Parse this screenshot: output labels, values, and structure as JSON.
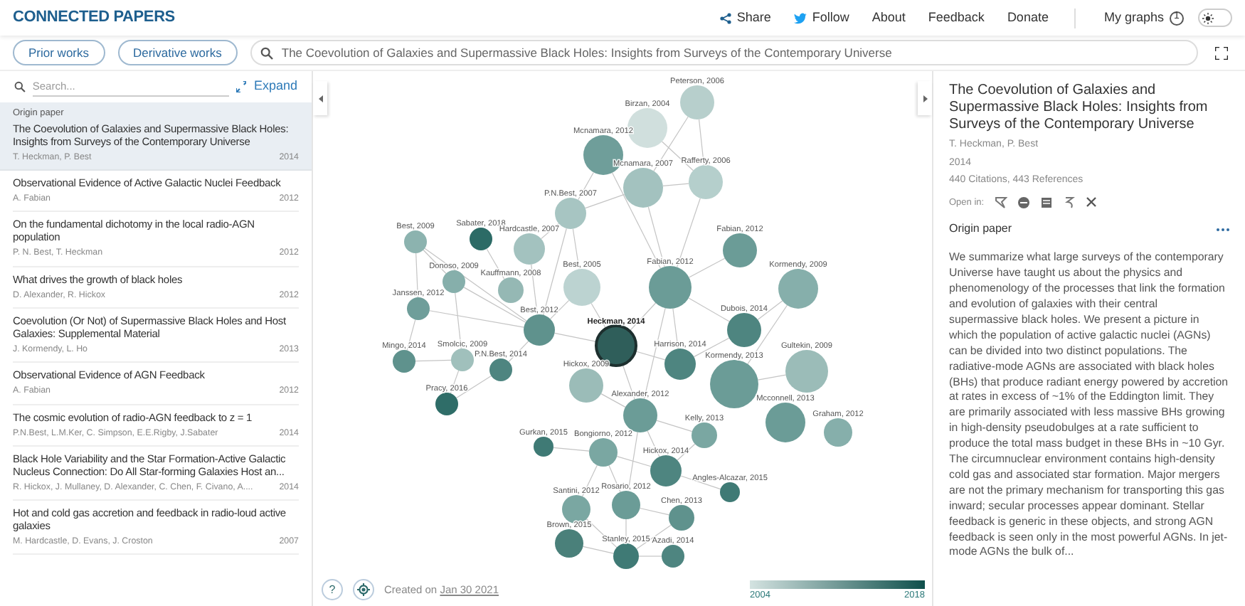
{
  "header": {
    "logo": "CONNECTED PAPERS",
    "nav": [
      {
        "kind": "share",
        "label": "Share"
      },
      {
        "kind": "follow",
        "label": "Follow"
      },
      {
        "kind": "plain",
        "label": "About"
      },
      {
        "kind": "plain",
        "label": "Feedback"
      },
      {
        "kind": "plain",
        "label": "Donate"
      }
    ],
    "my_graphs": {
      "label": "My graphs",
      "count": "1"
    },
    "dark_mode": false
  },
  "toolbar": {
    "buttons": [
      "Prior works",
      "Derivative works"
    ],
    "search_value": "The Coevolution of Galaxies and Supermassive Black Holes: Insights from Surveys of the Contemporary Universe"
  },
  "list_panel": {
    "search_placeholder": "Search...",
    "expand": "Expand",
    "papers": [
      {
        "tag": "Origin paper",
        "title": "The Coevolution of Galaxies and Supermassive Black Holes: Insights from Surveys of the Contemporary Universe",
        "authors": "T. Heckman, P. Best",
        "year": "2014",
        "selected": true
      },
      {
        "title": "Observational Evidence of Active Galactic Nuclei Feedback",
        "authors": "A. Fabian",
        "year": "2012",
        "selected": false
      },
      {
        "title": "On the fundamental dichotomy in the local radio-AGN population",
        "authors": "P. N. Best, T. Heckman",
        "year": "2012",
        "selected": false
      },
      {
        "title": "What drives the growth of black holes",
        "authors": "D. Alexander, R. Hickox",
        "year": "2012",
        "selected": false
      },
      {
        "title": "Coevolution (Or Not) of Supermassive Black Holes and Host Galaxies: Supplemental Material",
        "authors": "J. Kormendy, L. Ho",
        "year": "2013",
        "selected": false
      },
      {
        "title": "Observational Evidence of AGN Feedback",
        "authors": "A. Fabian",
        "year": "2012",
        "selected": false
      },
      {
        "title": "The cosmic evolution of radio-AGN feedback to z = 1",
        "authors": "P.N.Best, L.M.Ker, C. Simpson, E.E.Rigby, J.Sabater",
        "year": "2014",
        "selected": false
      },
      {
        "title": "Black Hole Variability and the Star Formation-Active Galactic Nucleus Connection: Do All Star-forming Galaxies Host an...",
        "authors": "R. Hickox, J. Mullaney, D. Alexander, C. Chen, F. Civano, A....",
        "year": "2014",
        "selected": false
      },
      {
        "title": "Hot and cold gas accretion and feedback in radio-loud active galaxies",
        "authors": "M. Hardcastle, D. Evans, J. Croston",
        "year": "2007",
        "selected": false
      }
    ]
  },
  "graph": {
    "nodes": [
      {
        "label": "Peterson, 2006",
        "color": "#b7cfcc",
        "selected": false
      },
      {
        "label": "Birzan, 2004",
        "color": "#d0dfdd",
        "selected": false
      },
      {
        "label": "Mcnamara, 2012",
        "color": "#6f9e9a",
        "selected": false
      },
      {
        "label": "Mcnamara, 2007",
        "color": "#a3c2bf",
        "selected": false
      },
      {
        "label": "Rafferty, 2006",
        "color": "#b5cfcc",
        "selected": false
      },
      {
        "label": "P.N.Best, 2007",
        "color": "#a7c5c2",
        "selected": false
      },
      {
        "label": "Fabian, 2012",
        "color": "#6b9c97",
        "selected": false
      },
      {
        "label": "Best, 2009",
        "color": "#8cb3af",
        "selected": false
      },
      {
        "label": "Sabater, 2018",
        "color": "#2c6b66",
        "selected": false
      },
      {
        "label": "Hardcastle, 2007",
        "color": "#a3c2bf",
        "selected": false
      },
      {
        "label": "Donoso, 2009",
        "color": "#86afab",
        "selected": false
      },
      {
        "label": "Best, 2005",
        "color": "#bcd3d1",
        "selected": false
      },
      {
        "label": "Kauffmann, 2008",
        "color": "#95b8b4",
        "selected": false
      },
      {
        "label": "Fabian, 2012",
        "color": "#6b9c97",
        "selected": false
      },
      {
        "label": "Kormendy, 2009",
        "color": "#86afab",
        "selected": false
      },
      {
        "label": "Janssen, 2012",
        "color": "#6f9e9a",
        "selected": false
      },
      {
        "label": "Best, 2012",
        "color": "#5f928d",
        "selected": false
      },
      {
        "label": "Dubois, 2014",
        "color": "#4e8580",
        "selected": false
      },
      {
        "label": "Heckman, 2014",
        "color": "#2f5e5a",
        "selected": true
      },
      {
        "label": "Mingo, 2014",
        "color": "#5f928d",
        "selected": false
      },
      {
        "label": "Smolcic, 2009",
        "color": "#a0c0bc",
        "selected": false
      },
      {
        "label": "P.N.Best, 2014",
        "color": "#4e8580",
        "selected": false
      },
      {
        "label": "Harrison, 2014",
        "color": "#4e8580",
        "selected": false
      },
      {
        "label": "Hickox, 2009",
        "color": "#9bbcb8",
        "selected": false
      },
      {
        "label": "Kormendy, 2013",
        "color": "#6b9c97",
        "selected": false
      },
      {
        "label": "Gultekin, 2009",
        "color": "#9bbcb8",
        "selected": false
      },
      {
        "label": "Pracy, 2016",
        "color": "#2f6d68",
        "selected": false
      },
      {
        "label": "Alexander, 2012",
        "color": "#6b9c97",
        "selected": false
      },
      {
        "label": "Mcconnell, 2013",
        "color": "#6b9c97",
        "selected": false
      },
      {
        "label": "Graham, 2012",
        "color": "#86afab",
        "selected": false
      },
      {
        "label": "Kelly, 2013",
        "color": "#7aa7a2",
        "selected": false
      },
      {
        "label": "Gurkan, 2015",
        "color": "#3f7a75",
        "selected": false
      },
      {
        "label": "Bongiorno, 2012",
        "color": "#7aa7a2",
        "selected": false
      },
      {
        "label": "Hickox, 2014",
        "color": "#4e8580",
        "selected": false
      },
      {
        "label": "Angles-Alcazar, 2015",
        "color": "#3f7a75",
        "selected": false
      },
      {
        "label": "Santini, 2012",
        "color": "#7aa7a2",
        "selected": false
      },
      {
        "label": "Rosario, 2012",
        "color": "#6b9c97",
        "selected": false
      },
      {
        "label": "Chen, 2013",
        "color": "#5f928d",
        "selected": false
      },
      {
        "label": "Brown, 2015",
        "color": "#4a807a",
        "selected": false
      },
      {
        "label": "Stanley, 2015",
        "color": "#3f7a75",
        "selected": false
      },
      {
        "label": "Azadi, 2014",
        "color": "#4e8580",
        "selected": false
      }
    ],
    "help": "?",
    "created_prefix": "Created on",
    "created_date": "Jan 30 2021",
    "legend": {
      "min": "2004",
      "max": "2018"
    }
  },
  "detail": {
    "title": "The Coevolution of Galaxies and Supermassive Black Holes: Insights from Surveys of the Contemporary Universe",
    "authors": "T. Heckman, P. Best",
    "year": "2014",
    "stats": "440 Citations, 443 References",
    "open_in": "Open in:",
    "section": "Origin paper",
    "abstract": "We summarize what large surveys of the contemporary Universe have taught us about the physics and phenomenology of the processes that link the formation and evolution of galaxies with their central supermassive black holes. We present a picture in which the population of active galactic nuclei (AGNs) can be divided into two distinct populations. The radiative-mode AGNs are associated with black holes (BHs) that produce radiant energy powered by accretion at rates in excess of ~1% of the Eddington limit. They are primarily associated with less massive BHs growing in high-density pseudobulges at a rate sufficient to produce the total mass budget in these BHs in ~10 Gyr. The circumnuclear environment contains high-density cold gas and associated star formation. Major mergers are not the primary mechanism for transporting this gas inward; secular processes appear dominant. Stellar feedback is generic in these objects, and strong AGN feedback is seen only in the most powerful AGNs. In jet-mode AGNs the bulk of..."
  }
}
